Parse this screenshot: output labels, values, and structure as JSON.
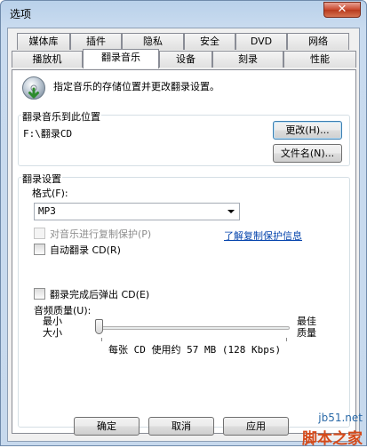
{
  "window": {
    "title": "选项",
    "close_glyph": "✕"
  },
  "tabs_row1": [
    "媒体库",
    "插件",
    "隐私",
    "安全",
    "DVD",
    "网络"
  ],
  "tabs_row2": [
    "播放机",
    "翻录音乐",
    "设备",
    "刻录",
    "性能"
  ],
  "active_tab": "翻录音乐",
  "panel": {
    "description": "指定音乐的存储位置并更改翻录设置。",
    "description_icon": "cd-rip-icon"
  },
  "location_group": {
    "title": "翻录音乐到此位置",
    "path": "F:\\翻录CD",
    "change_button": "更改(H)...",
    "filename_button": "文件名(N)..."
  },
  "settings_group": {
    "title": "翻录设置",
    "format_label": "格式(F):",
    "format_value": "MP3",
    "copy_protect_label": "对音乐进行复制保护(P)",
    "copy_protect_checked": false,
    "copy_protect_enabled": false,
    "learn_link": "了解复制保护信息",
    "auto_rip_label": "自动翻录 CD(R)",
    "auto_rip_checked": false,
    "eject_label": "翻录完成后弹出 CD(E)",
    "eject_checked": false,
    "quality_label": "音频质量(U):",
    "quality_min_top": "最小",
    "quality_min_bottom": "大小",
    "quality_max_top": "最佳",
    "quality_max_bottom": "质量",
    "quality_level": 0,
    "quality_info": "每张 CD 使用约 57 MB (128 Kbps)"
  },
  "buttons": {
    "ok": "确定",
    "cancel": "取消",
    "apply": "应用"
  },
  "watermark": {
    "url": "jb51.net",
    "name": "脚本之家"
  },
  "colors": {
    "link": "#0645ad",
    "close": "#c9472c",
    "title_bg": "#b9d1ea"
  }
}
